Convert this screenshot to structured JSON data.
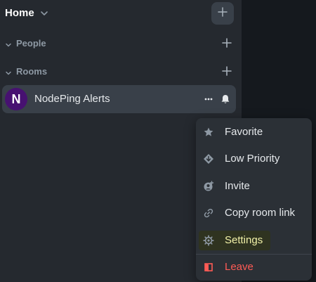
{
  "header": {
    "title": "Home"
  },
  "sections": [
    {
      "label": "People"
    },
    {
      "label": "Rooms"
    }
  ],
  "room": {
    "avatar_letter": "N",
    "name": "NodePing Alerts"
  },
  "menu": {
    "items": [
      {
        "label": "Favorite",
        "icon": "star-icon"
      },
      {
        "label": "Low Priority",
        "icon": "arrow-down-diamond-icon"
      },
      {
        "label": "Invite",
        "icon": "invite-user-icon"
      },
      {
        "label": "Copy room link",
        "icon": "link-icon"
      },
      {
        "label": "Settings",
        "icon": "gear-icon"
      },
      {
        "label": "Leave",
        "icon": "door-exit-icon"
      }
    ]
  },
  "colors": {
    "sidebar_bg": "#25292f",
    "selected_row_bg": "#394049",
    "avatar_bg": "#471171",
    "menu_bg": "#2b3036",
    "danger": "#ff5b55",
    "settings_highlight_text": "#f2f2a8"
  }
}
